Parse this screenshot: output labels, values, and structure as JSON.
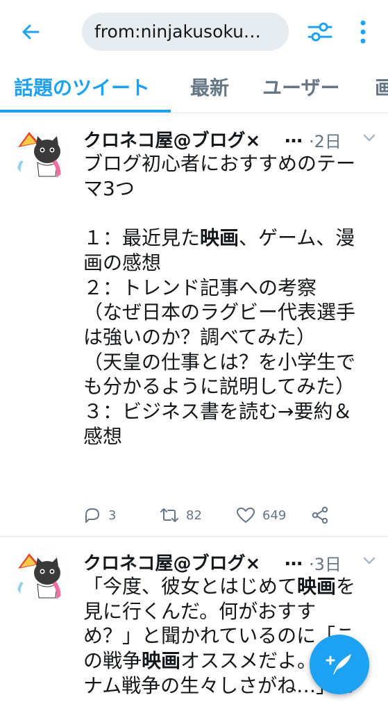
{
  "header": {
    "search_query": "from:ninjakusokuhou",
    "search_display": "from:ninjakusoku…"
  },
  "tabs": [
    {
      "label": "話題のツイート",
      "active": true
    },
    {
      "label": "最新",
      "active": false
    },
    {
      "label": "ユーザー",
      "active": false
    },
    {
      "label": "画",
      "active": false
    }
  ],
  "tweets": [
    {
      "author": "クロネコ屋@ブログ×",
      "ellipsis": "…",
      "time": "·2日",
      "lines": [
        [
          {
            "t": "ブログ初心者におすすめのテー"
          }
        ],
        [
          {
            "t": "マ3つ"
          }
        ],
        [
          {
            "t": ""
          }
        ],
        [
          {
            "t": "１：最近見た"
          },
          {
            "t": "映画",
            "b": true
          },
          {
            "t": "、ゲーム、漫"
          }
        ],
        [
          {
            "t": "画の感想"
          }
        ],
        [
          {
            "t": "２：トレンド記事への考察"
          }
        ],
        [
          {
            "t": "（なぜ日本のラグビー代表選手"
          }
        ],
        [
          {
            "t": "は強いのか？調べてみた）"
          }
        ],
        [
          {
            "t": "（天皇の仕事とは？を小学生で"
          }
        ],
        [
          {
            "t": "も分かるように説明してみた）"
          }
        ],
        [
          {
            "t": "３：ビジネス書を読む→要約＆"
          }
        ],
        [
          {
            "t": "感想"
          }
        ]
      ],
      "replies": "3",
      "retweets": "82",
      "likes": "649"
    },
    {
      "author": "クロネコ屋@ブログ×",
      "ellipsis": "…",
      "time": "·3日",
      "lines": [
        [
          {
            "t": "「今度、彼女とはじめて"
          },
          {
            "t": "映画",
            "b": true
          },
          {
            "t": "を"
          }
        ],
        [
          {
            "t": "見に行くんだ。何がおすす"
          }
        ],
        [
          {
            "t": "め？」と聞かれているのに「こ"
          }
        ],
        [
          {
            "t": "の戦争"
          },
          {
            "t": "映画",
            "b": true
          },
          {
            "t": "オススメだよ。ベト"
          }
        ],
        [
          {
            "t": "ナム戦争の生々しさがね…」と"
          }
        ]
      ]
    }
  ],
  "colors": {
    "accent": "#1da1f2",
    "text": "#14171a",
    "muted": "#657786",
    "divider": "#e1e8ed",
    "search_bg": "#e6ecf0"
  },
  "icons": [
    "back-arrow-icon",
    "filter-sliders-icon",
    "more-vertical-icon",
    "chevron-down-icon",
    "reply-icon",
    "retweet-icon",
    "like-heart-icon",
    "share-icon",
    "compose-tweet-icon"
  ]
}
